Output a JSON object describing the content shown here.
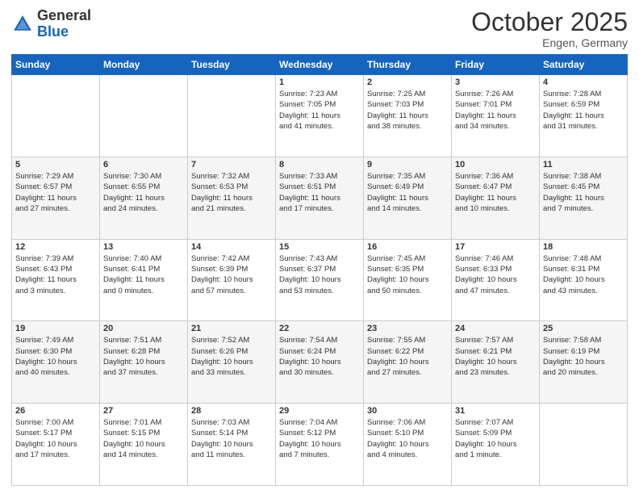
{
  "header": {
    "logo_general": "General",
    "logo_blue": "Blue",
    "month_title": "October 2025",
    "subtitle": "Engen, Germany"
  },
  "days_of_week": [
    "Sunday",
    "Monday",
    "Tuesday",
    "Wednesday",
    "Thursday",
    "Friday",
    "Saturday"
  ],
  "weeks": [
    [
      {
        "day": "",
        "info": ""
      },
      {
        "day": "",
        "info": ""
      },
      {
        "day": "",
        "info": ""
      },
      {
        "day": "1",
        "info": "Sunrise: 7:23 AM\nSunset: 7:05 PM\nDaylight: 11 hours\nand 41 minutes."
      },
      {
        "day": "2",
        "info": "Sunrise: 7:25 AM\nSunset: 7:03 PM\nDaylight: 11 hours\nand 38 minutes."
      },
      {
        "day": "3",
        "info": "Sunrise: 7:26 AM\nSunset: 7:01 PM\nDaylight: 11 hours\nand 34 minutes."
      },
      {
        "day": "4",
        "info": "Sunrise: 7:28 AM\nSunset: 6:59 PM\nDaylight: 11 hours\nand 31 minutes."
      }
    ],
    [
      {
        "day": "5",
        "info": "Sunrise: 7:29 AM\nSunset: 6:57 PM\nDaylight: 11 hours\nand 27 minutes."
      },
      {
        "day": "6",
        "info": "Sunrise: 7:30 AM\nSunset: 6:55 PM\nDaylight: 11 hours\nand 24 minutes."
      },
      {
        "day": "7",
        "info": "Sunrise: 7:32 AM\nSunset: 6:53 PM\nDaylight: 11 hours\nand 21 minutes."
      },
      {
        "day": "8",
        "info": "Sunrise: 7:33 AM\nSunset: 6:51 PM\nDaylight: 11 hours\nand 17 minutes."
      },
      {
        "day": "9",
        "info": "Sunrise: 7:35 AM\nSunset: 6:49 PM\nDaylight: 11 hours\nand 14 minutes."
      },
      {
        "day": "10",
        "info": "Sunrise: 7:36 AM\nSunset: 6:47 PM\nDaylight: 11 hours\nand 10 minutes."
      },
      {
        "day": "11",
        "info": "Sunrise: 7:38 AM\nSunset: 6:45 PM\nDaylight: 11 hours\nand 7 minutes."
      }
    ],
    [
      {
        "day": "12",
        "info": "Sunrise: 7:39 AM\nSunset: 6:43 PM\nDaylight: 11 hours\nand 3 minutes."
      },
      {
        "day": "13",
        "info": "Sunrise: 7:40 AM\nSunset: 6:41 PM\nDaylight: 11 hours\nand 0 minutes."
      },
      {
        "day": "14",
        "info": "Sunrise: 7:42 AM\nSunset: 6:39 PM\nDaylight: 10 hours\nand 57 minutes."
      },
      {
        "day": "15",
        "info": "Sunrise: 7:43 AM\nSunset: 6:37 PM\nDaylight: 10 hours\nand 53 minutes."
      },
      {
        "day": "16",
        "info": "Sunrise: 7:45 AM\nSunset: 6:35 PM\nDaylight: 10 hours\nand 50 minutes."
      },
      {
        "day": "17",
        "info": "Sunrise: 7:46 AM\nSunset: 6:33 PM\nDaylight: 10 hours\nand 47 minutes."
      },
      {
        "day": "18",
        "info": "Sunrise: 7:48 AM\nSunset: 6:31 PM\nDaylight: 10 hours\nand 43 minutes."
      }
    ],
    [
      {
        "day": "19",
        "info": "Sunrise: 7:49 AM\nSunset: 6:30 PM\nDaylight: 10 hours\nand 40 minutes."
      },
      {
        "day": "20",
        "info": "Sunrise: 7:51 AM\nSunset: 6:28 PM\nDaylight: 10 hours\nand 37 minutes."
      },
      {
        "day": "21",
        "info": "Sunrise: 7:52 AM\nSunset: 6:26 PM\nDaylight: 10 hours\nand 33 minutes."
      },
      {
        "day": "22",
        "info": "Sunrise: 7:54 AM\nSunset: 6:24 PM\nDaylight: 10 hours\nand 30 minutes."
      },
      {
        "day": "23",
        "info": "Sunrise: 7:55 AM\nSunset: 6:22 PM\nDaylight: 10 hours\nand 27 minutes."
      },
      {
        "day": "24",
        "info": "Sunrise: 7:57 AM\nSunset: 6:21 PM\nDaylight: 10 hours\nand 23 minutes."
      },
      {
        "day": "25",
        "info": "Sunrise: 7:58 AM\nSunset: 6:19 PM\nDaylight: 10 hours\nand 20 minutes."
      }
    ],
    [
      {
        "day": "26",
        "info": "Sunrise: 7:00 AM\nSunset: 5:17 PM\nDaylight: 10 hours\nand 17 minutes."
      },
      {
        "day": "27",
        "info": "Sunrise: 7:01 AM\nSunset: 5:15 PM\nDaylight: 10 hours\nand 14 minutes."
      },
      {
        "day": "28",
        "info": "Sunrise: 7:03 AM\nSunset: 5:14 PM\nDaylight: 10 hours\nand 11 minutes."
      },
      {
        "day": "29",
        "info": "Sunrise: 7:04 AM\nSunset: 5:12 PM\nDaylight: 10 hours\nand 7 minutes."
      },
      {
        "day": "30",
        "info": "Sunrise: 7:06 AM\nSunset: 5:10 PM\nDaylight: 10 hours\nand 4 minutes."
      },
      {
        "day": "31",
        "info": "Sunrise: 7:07 AM\nSunset: 5:09 PM\nDaylight: 10 hours\nand 1 minute."
      },
      {
        "day": "",
        "info": ""
      }
    ]
  ]
}
